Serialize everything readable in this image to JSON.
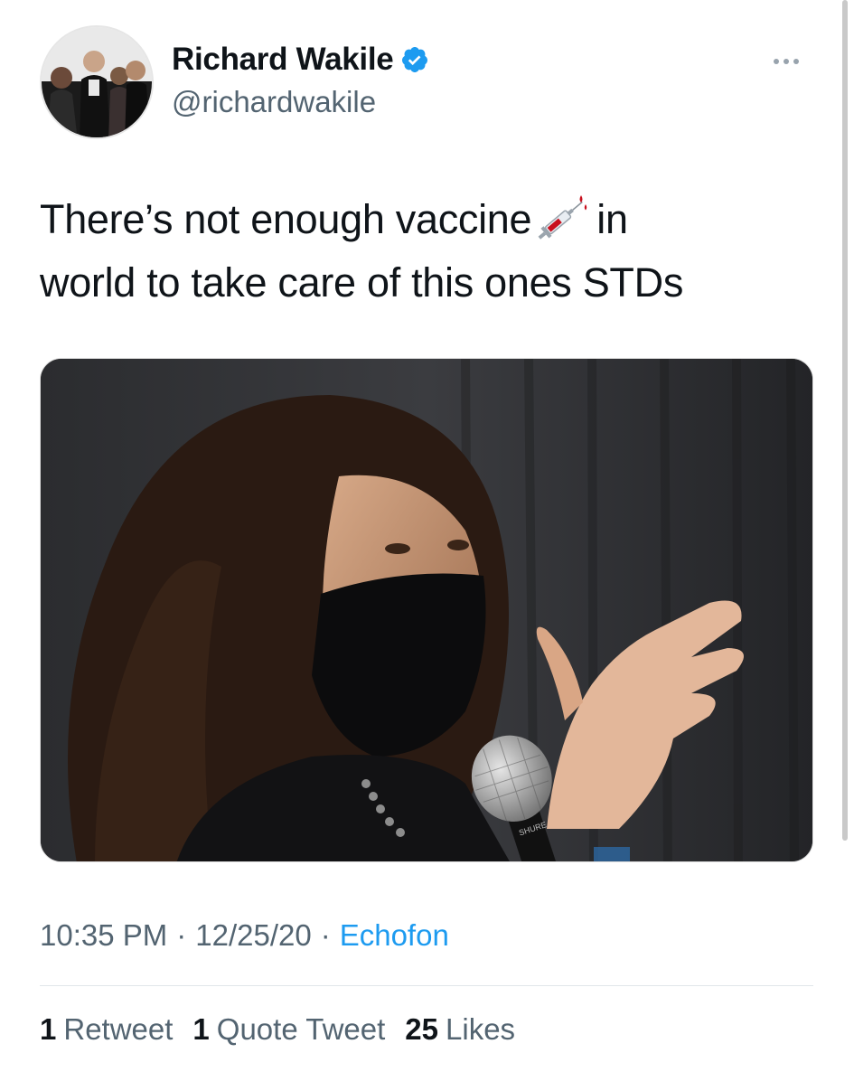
{
  "tweet": {
    "display_name": "Richard Wakile",
    "handle": "@richardwakile",
    "verified": true,
    "text_line1": "There’s not enough vaccine",
    "text_after_emoji": "in",
    "text_line2": "world to take care of this ones STDs",
    "emoji": "syringe-icon",
    "media_label": "SHURE",
    "meta": {
      "time": "10:35 PM",
      "date": "12/25/20",
      "separator": "·",
      "source": "Echofon"
    },
    "stats": {
      "retweets_count": "1",
      "retweets_label": "Retweet",
      "quotes_count": "1",
      "quotes_label": "Quote Tweet",
      "likes_count": "25",
      "likes_label": "Likes"
    }
  },
  "colors": {
    "accent": "#1d9bf0",
    "secondary_text": "#536471",
    "primary_text": "#0f1419"
  }
}
